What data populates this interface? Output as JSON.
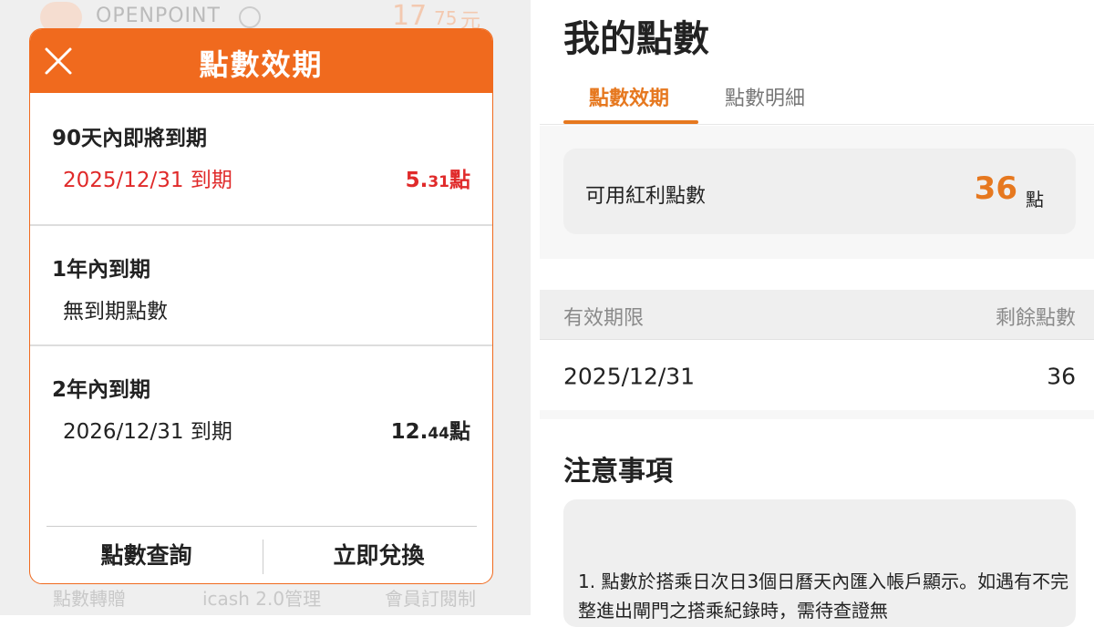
{
  "background": {
    "logo_text": "OPENPOINT",
    "amount": "17",
    "amount_decimal": "75",
    "currency": "元",
    "bottom_links": [
      "點數轉贈",
      "icash 2.0管理",
      "會員訂閱制"
    ]
  },
  "modal": {
    "title": "點數效期",
    "sections": [
      {
        "title": "90天內即將到期",
        "row": {
          "date": "2025/12/31 到期",
          "points_int": "5.",
          "points_dec": "31",
          "unit": "點",
          "highlight": true
        }
      },
      {
        "title": "1年內到期",
        "row": {
          "text": "無到期點數"
        }
      },
      {
        "title": "2年內到期",
        "row": {
          "date": "2026/12/31 到期",
          "points_int": "12.",
          "points_dec": "44",
          "unit": "點",
          "highlight": false
        }
      }
    ],
    "footer": {
      "left_button": "點數查詢",
      "right_button": "立即兌換"
    }
  },
  "page": {
    "title": "我的點數",
    "tabs": [
      {
        "label": "點數效期",
        "active": true
      },
      {
        "label": "點數明細",
        "active": false
      }
    ],
    "available": {
      "label": "可用紅利點數",
      "value": "36",
      "unit": "點"
    },
    "table": {
      "headers": [
        "有效期限",
        "剩餘點數"
      ],
      "rows": [
        {
          "date": "2025/12/31",
          "points": "36"
        }
      ]
    },
    "notes": {
      "title": "注意事項",
      "text": "1. 點數於搭乘日次日3個日曆天內匯入帳戶顯示。如遇有不完整進出閘門之搭乘紀錄時，需待查證無"
    }
  },
  "colors": {
    "accent": "#f06a1e",
    "tab_accent": "#e6781f",
    "alert_red": "#e02a2a"
  }
}
